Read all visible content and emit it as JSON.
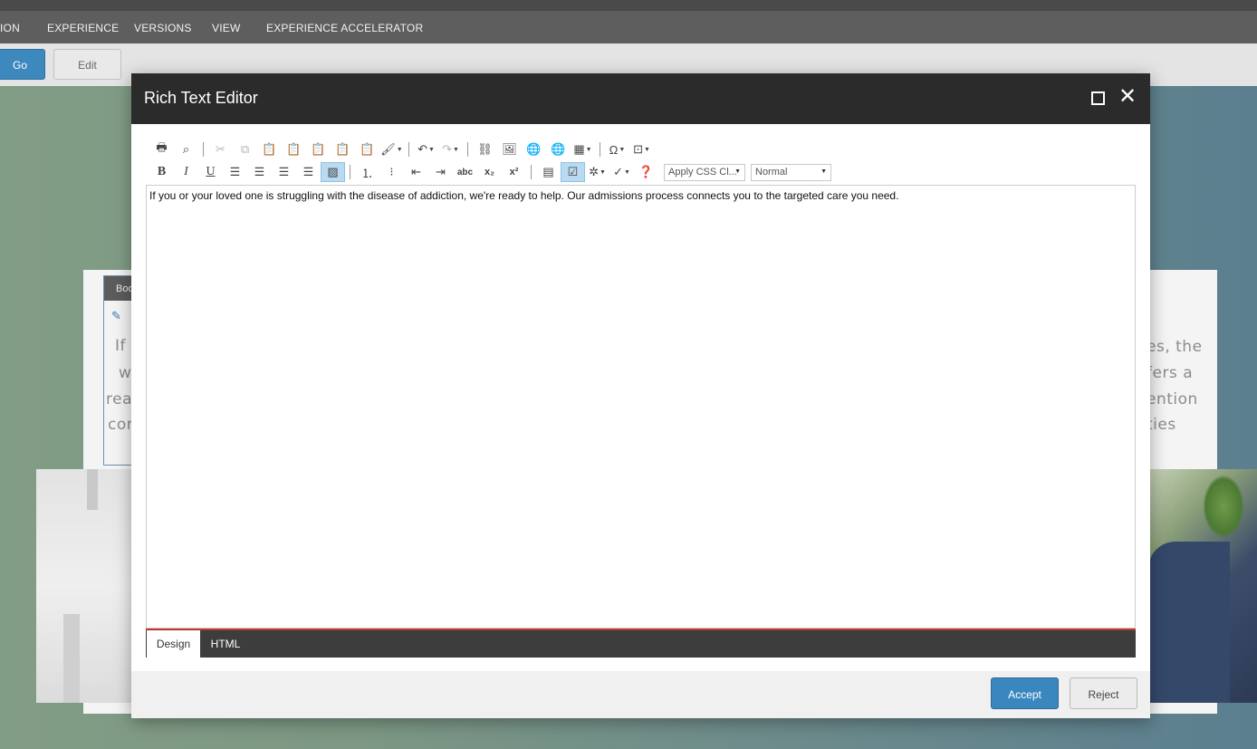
{
  "ribbon": {
    "tabs": [
      "ION",
      "EXPERIENCE",
      "VERSIONS",
      "VIEW",
      "EXPERIENCE ACCELERATOR"
    ]
  },
  "toolbar": {
    "go_label": "Go",
    "edit_label": "Edit"
  },
  "background": {
    "field_header": "Boo",
    "left_lines": [
      "If y",
      "w",
      "rea",
      "cor"
    ],
    "right_lines": [
      "es, the",
      "fers a",
      "ention",
      "ties"
    ]
  },
  "dialog": {
    "title": "Rich Text Editor",
    "toolbar": {
      "css_class_placeholder": "Apply CSS Cl...",
      "format_value": "Normal",
      "row1_icons": [
        "print-icon",
        "find-icon",
        "cut-icon",
        "copy-icon",
        "paste-icon",
        "paste-word-icon",
        "paste-plain-icon",
        "paste-html-icon",
        "paste-markdown-icon",
        "format-painter-icon",
        "undo-icon",
        "redo-icon",
        "link-manager-icon",
        "image-manager-icon",
        "hyperlink-icon",
        "unlink-icon",
        "table-icon",
        "special-char-icon",
        "insert-snippet-icon"
      ],
      "row2_icons": [
        "bold-icon",
        "italic-icon",
        "underline-icon",
        "align-left-icon",
        "align-center-icon",
        "align-right-icon",
        "justify-icon",
        "clear-format-icon",
        "numbered-list-icon",
        "bulleted-list-icon",
        "outdent-icon",
        "indent-icon",
        "strikethrough-icon",
        "subscript-icon",
        "superscript-icon",
        "paragraph-icon",
        "check-icon",
        "media-icon",
        "spellcheck-icon",
        "help-icon"
      ]
    },
    "content": "If you or your loved one is struggling with the disease of addiction, we're ready to help. Our admissions process connects you to the targeted care you need.",
    "modes": {
      "design": "Design",
      "html": "HTML"
    },
    "accept_label": "Accept",
    "reject_label": "Reject"
  }
}
